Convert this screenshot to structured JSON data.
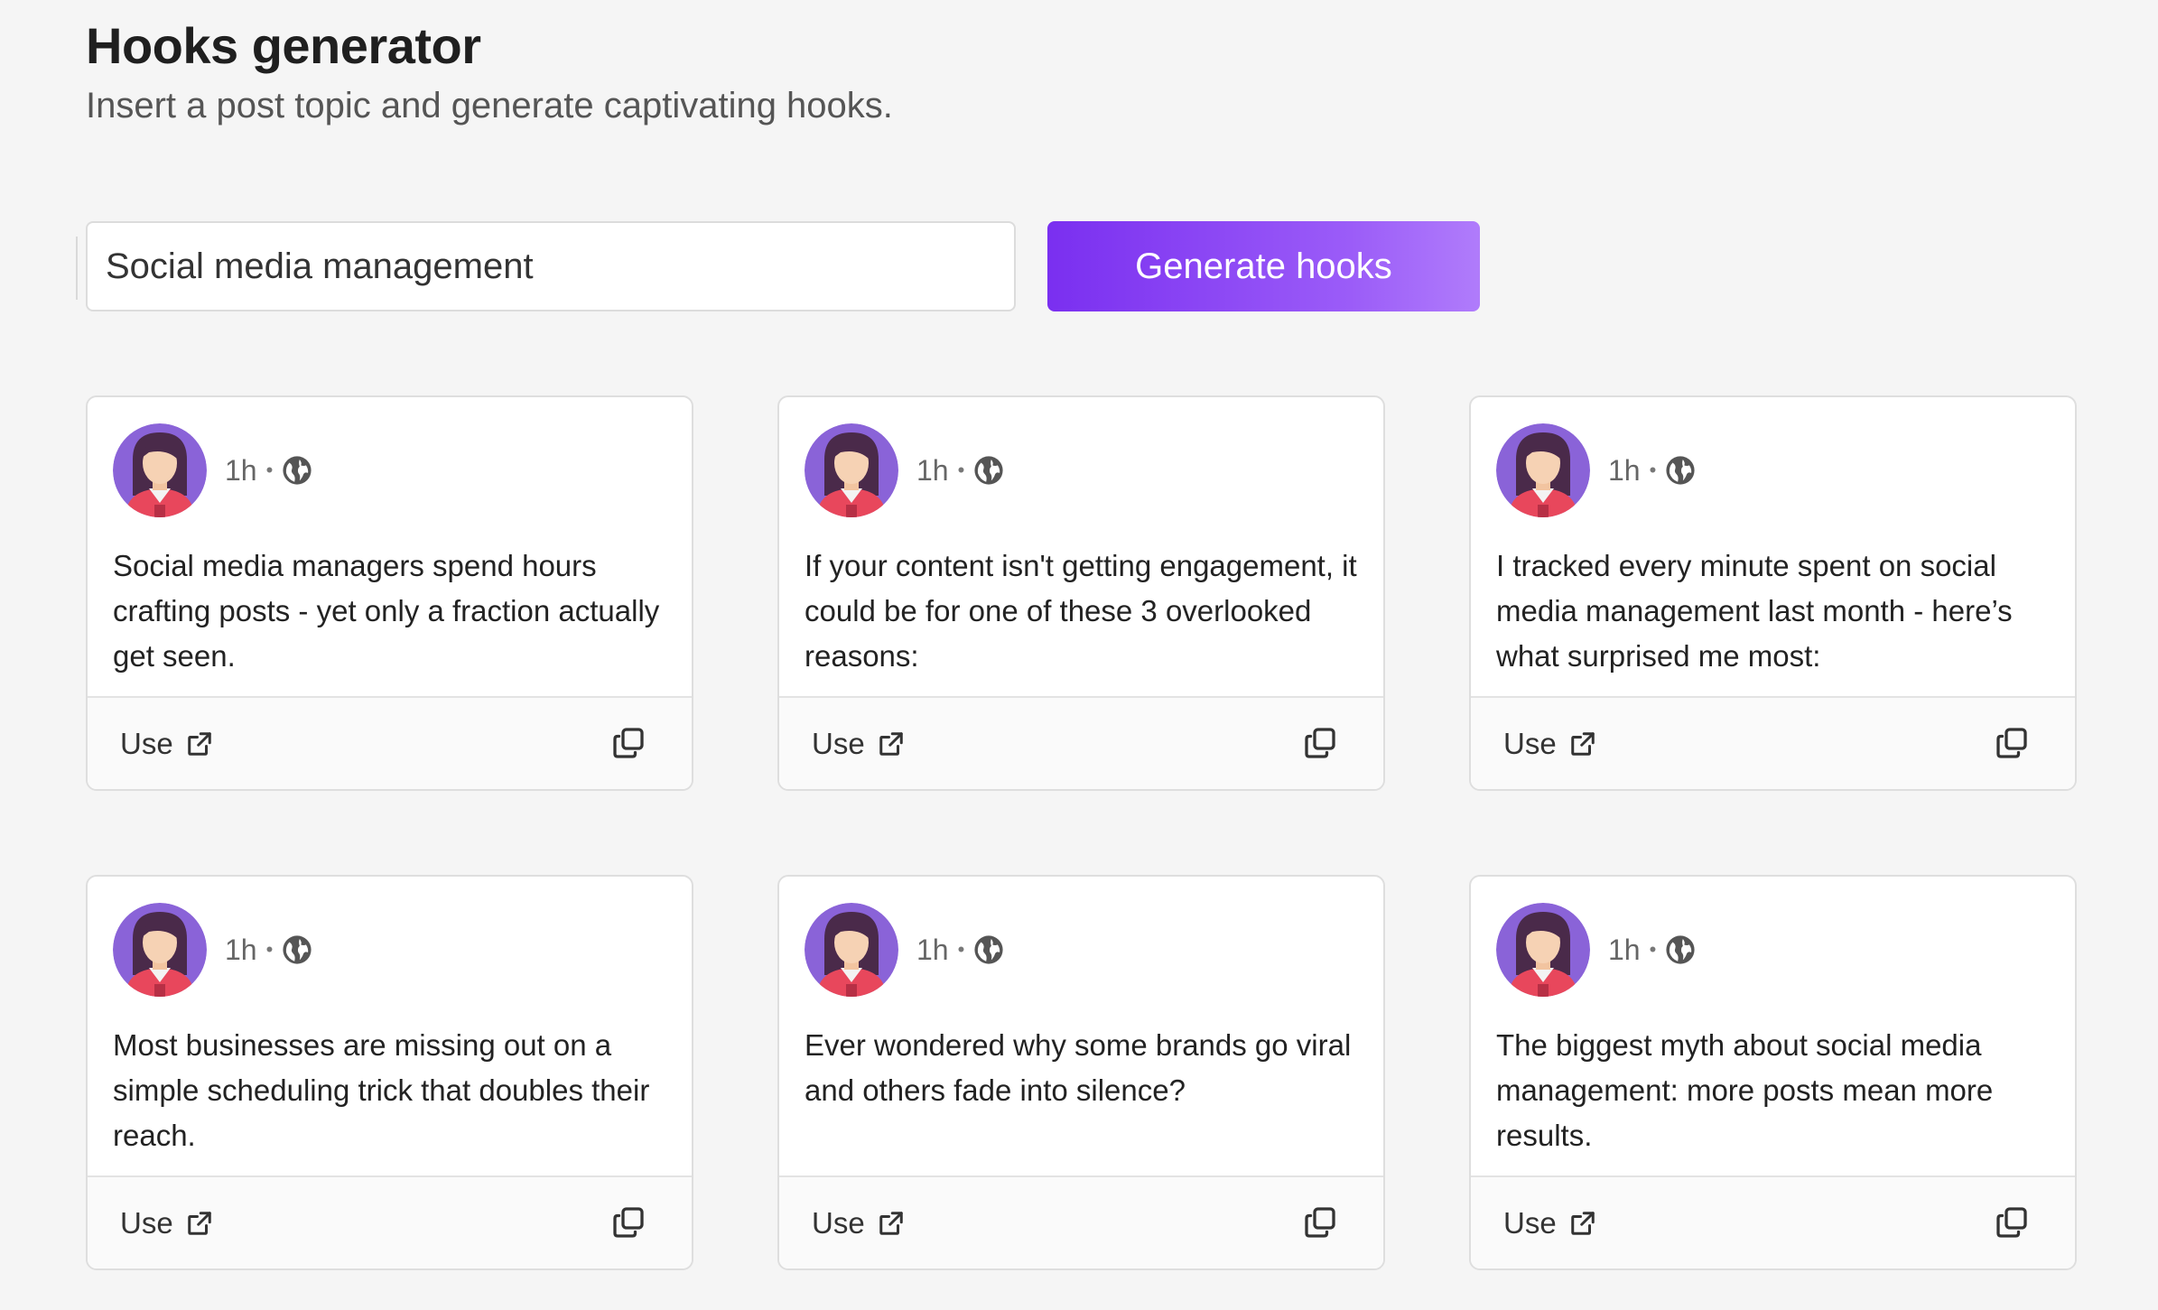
{
  "header": {
    "title": "Hooks generator",
    "subtitle": "Insert a post topic and generate captivating hooks."
  },
  "form": {
    "topic_value": "Social media management",
    "generate_label": "Generate hooks"
  },
  "colors": {
    "accent_start": "#7a2ff0",
    "accent_end": "#b07cfb",
    "avatar_bg": "#8a63d8",
    "avatar_shirt": "#e8475c"
  },
  "cards": [
    {
      "time": "1h",
      "separator": "•",
      "icon": "globe-icon",
      "text": "Social media managers spend hours crafting posts - yet only a fraction actually get seen.",
      "use_label": "Use"
    },
    {
      "time": "1h",
      "separator": "•",
      "icon": "globe-icon",
      "text": "If your content isn't getting engagement, it could be for one of these 3 overlooked reasons:",
      "use_label": "Use"
    },
    {
      "time": "1h",
      "separator": "•",
      "icon": "globe-icon",
      "text": "I tracked every minute spent on social media management last month - here’s what surprised me most:",
      "use_label": "Use"
    },
    {
      "time": "1h",
      "separator": "•",
      "icon": "globe-icon",
      "text": "Most businesses are missing out on a simple scheduling trick that doubles their reach.",
      "use_label": "Use"
    },
    {
      "time": "1h",
      "separator": "•",
      "icon": "globe-icon",
      "text": "Ever wondered why some brands go viral and others fade into silence?",
      "use_label": "Use"
    },
    {
      "time": "1h",
      "separator": "•",
      "icon": "globe-icon",
      "text": "The biggest myth about social media management: more posts mean more results.",
      "use_label": "Use"
    }
  ]
}
